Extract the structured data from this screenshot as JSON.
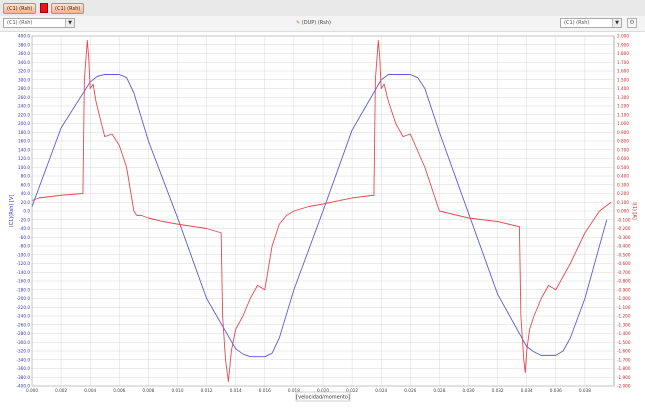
{
  "tabs": [
    {
      "label": "(C1) (Rsh)"
    },
    {
      "label": "(C1) (Rsh)"
    }
  ],
  "toolbar": {
    "left_select_value": "(C1) (Rsh)",
    "right_select_value": "(C1) (Rsh)",
    "center_label": "(DUP) (Rsh)"
  },
  "chart_data": {
    "type": "line",
    "xlabel": "[velocidad/momento]",
    "ylabel_left": "(C1)(Rsh) [V]",
    "ylabel_right": "I(1) [A]",
    "xlim": [
      0.0,
      0.04
    ],
    "ylim_left": [
      -400.0,
      400.0
    ],
    "ylim_right": [
      -2.0,
      2.0
    ],
    "x_ticks": [
      "0.000",
      "0.002",
      "0.004",
      "0.006",
      "0.008",
      "0.010",
      "0.012",
      "0.014",
      "0.016",
      "0.018",
      "0.020",
      "0.022",
      "0.024",
      "0.026",
      "0.028",
      "0.030",
      "0.032",
      "0.034",
      "0.036",
      "0.038"
    ],
    "y_left_ticks": [
      "400.0",
      "380.0",
      "360.0",
      "340.0",
      "320.0",
      "300.0",
      "280.0",
      "260.0",
      "240.0",
      "220.0",
      "200.0",
      "180.0",
      "160.0",
      "140.0",
      "120.0",
      "100.0",
      "80.0",
      "60.0",
      "40.0",
      "20.0",
      "0.0",
      "-20.0",
      "-40.0",
      "-60.0",
      "-80.0",
      "-100.0",
      "-120.0",
      "-140.0",
      "-160.0",
      "-180.0",
      "-200.0",
      "-220.0",
      "-240.0",
      "-260.0",
      "-280.0",
      "-300.0",
      "-320.0",
      "-340.0",
      "-360.0",
      "-380.0",
      "-400.0"
    ],
    "y_right_ticks": [
      "2.000",
      "1.900",
      "1.800",
      "1.700",
      "1.600",
      "1.500",
      "1.400",
      "1.300",
      "1.200",
      "1.100",
      "1.000",
      "0.900",
      "0.800",
      "0.700",
      "0.600",
      "0.500",
      "0.400",
      "0.300",
      "0.200",
      "0.100",
      "0.000",
      "-0.100",
      "-0.200",
      "-0.300",
      "-0.400",
      "-0.500",
      "-0.600",
      "-0.700",
      "-0.800",
      "-0.900",
      "-1.000",
      "-1.100",
      "-1.200",
      "-1.300",
      "-1.400",
      "-1.500",
      "-1.600",
      "-1.700",
      "-1.800",
      "-1.900",
      "-2.000"
    ],
    "grid": true,
    "colors": {
      "voltage": "#5b5bd6",
      "current": "#e8484f",
      "left_axis_text": "#3030c0",
      "right_axis_text": "#d02020"
    },
    "series": [
      {
        "axis": "left",
        "x": [
          0.0,
          0.002,
          0.004,
          0.0045,
          0.005,
          0.006,
          0.0065,
          0.007,
          0.008,
          0.01,
          0.012,
          0.014,
          0.0145,
          0.015,
          0.016,
          0.0165,
          0.017,
          0.018,
          0.02,
          0.022,
          0.024,
          0.0245,
          0.025,
          0.026,
          0.0265,
          0.027,
          0.028,
          0.03,
          0.032,
          0.034,
          0.0345,
          0.035,
          0.036,
          0.0365,
          0.037,
          0.038,
          0.0395
        ],
        "values": [
          10,
          190,
          295,
          308,
          312,
          312,
          305,
          270,
          160,
          -15,
          -200,
          -315,
          -327,
          -333,
          -333,
          -325,
          -290,
          -180,
          0,
          185,
          300,
          312,
          312,
          312,
          305,
          280,
          180,
          -5,
          -190,
          -310,
          -322,
          -330,
          -330,
          -320,
          -290,
          -200,
          -20
        ]
      },
      {
        "axis": "right",
        "x": [
          0.0,
          0.0005,
          0.002,
          0.0035,
          0.0036,
          0.0038,
          0.0039,
          0.004,
          0.0042,
          0.0044,
          0.0048,
          0.005,
          0.0055,
          0.006,
          0.0065,
          0.007,
          0.0072,
          0.0075,
          0.008,
          0.0085,
          0.009,
          0.01,
          0.012,
          0.013,
          0.0131,
          0.0133,
          0.0135,
          0.0137,
          0.014,
          0.0145,
          0.015,
          0.0155,
          0.016,
          0.0162,
          0.0165,
          0.017,
          0.0175,
          0.018,
          0.019,
          0.02,
          0.022,
          0.0235,
          0.0236,
          0.0238,
          0.0239,
          0.024,
          0.0242,
          0.0245,
          0.025,
          0.0255,
          0.026,
          0.027,
          0.028,
          0.03,
          0.032,
          0.0335,
          0.0336,
          0.0338,
          0.0339,
          0.034,
          0.0342,
          0.0345,
          0.035,
          0.0355,
          0.036,
          0.037,
          0.038,
          0.039,
          0.0398
        ],
        "values": [
          0.12,
          0.15,
          0.18,
          0.2,
          1.5,
          1.95,
          1.75,
          1.4,
          1.45,
          1.25,
          0.98,
          0.85,
          0.88,
          0.75,
          0.5,
          0.0,
          -0.05,
          -0.05,
          -0.08,
          -0.1,
          -0.12,
          -0.15,
          -0.2,
          -0.25,
          -1.2,
          -1.7,
          -1.95,
          -1.6,
          -1.35,
          -1.2,
          -1.0,
          -0.85,
          -0.9,
          -0.7,
          -0.4,
          -0.15,
          -0.05,
          0.0,
          0.05,
          0.08,
          0.15,
          0.18,
          1.5,
          1.95,
          1.75,
          1.4,
          1.45,
          1.25,
          1.0,
          0.85,
          0.88,
          0.5,
          0.0,
          -0.08,
          -0.12,
          -0.18,
          -1.2,
          -1.7,
          -1.85,
          -1.6,
          -1.35,
          -1.2,
          -1.0,
          -0.85,
          -0.9,
          -0.6,
          -0.25,
          0.0,
          0.1
        ]
      }
    ]
  }
}
